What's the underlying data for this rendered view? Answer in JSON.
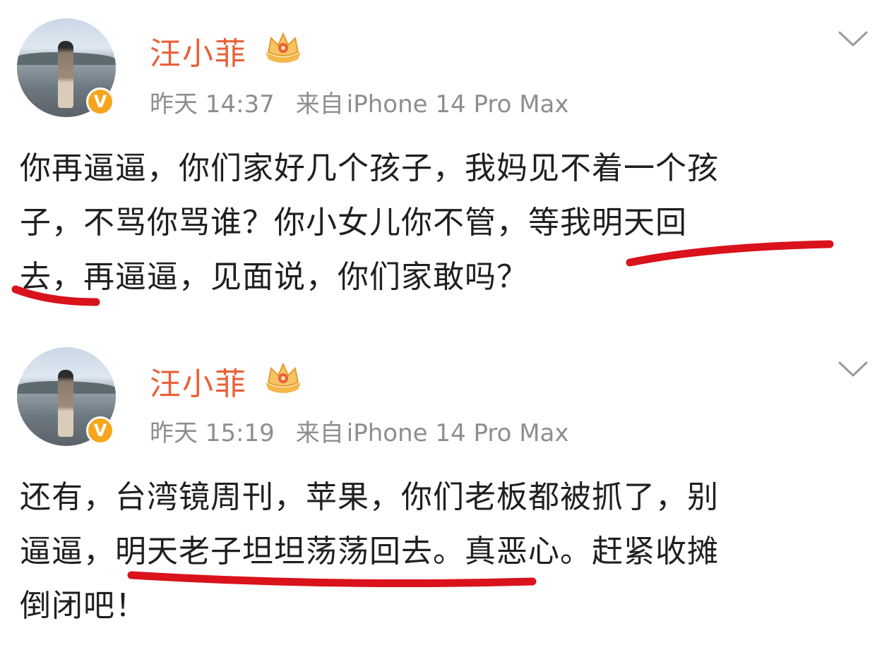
{
  "posts": [
    {
      "username": "汪小菲",
      "verified_badge": "V",
      "time": "昨天 14:37",
      "source_label": "来自",
      "device": "iPhone 14 Pro Max",
      "content_lines": [
        "你再逼逼，你们家好几个孩子，我妈见不着一个孩",
        "子，不骂你骂谁？你小女儿你不管，等我明天回",
        "去，再逼逼，见面说，你们家敢吗？"
      ]
    },
    {
      "username": "汪小菲",
      "verified_badge": "V",
      "time": "昨天 15:19",
      "source_label": "来自",
      "device": "iPhone 14 Pro Max",
      "content_lines": [
        "还有，台湾镜周刊，苹果，你们老板都被抓了，别",
        "逼逼，明天老子坦坦荡荡回去。真恶心。赶紧收摊",
        "倒闭吧！"
      ]
    }
  ],
  "icons": {
    "menu": "chevron-down-icon",
    "crown": "crown-icon",
    "verified": "verified-badge-icon"
  },
  "colors": {
    "username": "#e8613a",
    "meta": "#8e8e8e",
    "text": "#1f1f1f",
    "verified": "#f7a51c",
    "annotation": "#d9121b"
  }
}
